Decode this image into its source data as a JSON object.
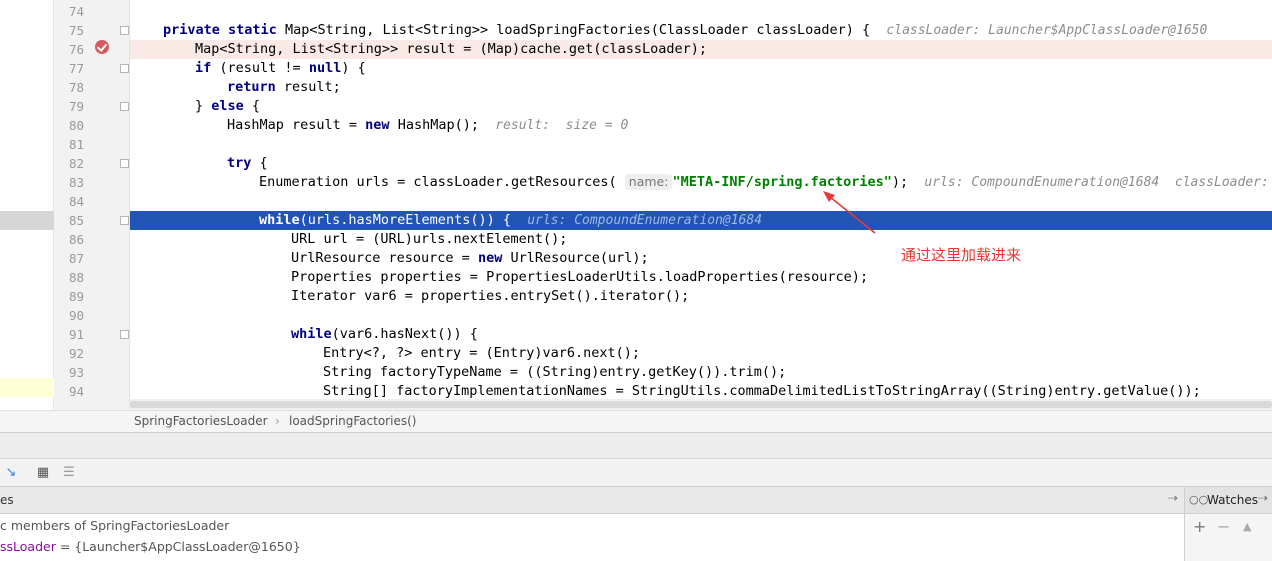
{
  "editor": {
    "line_numbers": [
      "74",
      "75",
      "76",
      "77",
      "78",
      "79",
      "80",
      "81",
      "82",
      "83",
      "84",
      "85",
      "86",
      "87",
      "88",
      "89",
      "90",
      "91",
      "92",
      "93",
      "94"
    ],
    "code": {
      "l75_private": "private",
      "l75_static": "static",
      "l75_sig": " Map<String, List<String>> loadSpringFactories(ClassLoader classLoader) {",
      "l75_hint": "classLoader: Launcher$AppClassLoader@1650",
      "l76": "Map<String, List<String>> result = (Map)cache.get(classLoader);",
      "l77_if": "if",
      "l77_a": " (result != ",
      "l77_null": "null",
      "l77_b": ") {",
      "l78_return": "return",
      "l78_b": " result;",
      "l79_a": "} ",
      "l79_else": "else",
      "l79_b": " {",
      "l80_a": "HashMap result = ",
      "l80_new": "new",
      "l80_b": " HashMap();",
      "l80_hint": "result:  size = 0",
      "l82_try": "try",
      "l82_b": " {",
      "l83_a": "Enumeration urls = classLoader.getResources(",
      "l83_param": "name:",
      "l83_str": "\"META-INF/spring.factories\"",
      "l83_b": ");",
      "l83_hint": "urls: CompoundEnumeration@1684  classLoader:",
      "l85_while": "while",
      "l85_b": "(urls.hasMoreElements()) {",
      "l85_hint": "urls: CompoundEnumeration@1684",
      "l86": "URL url = (URL)urls.nextElement();",
      "l87_a": "UrlResource resource = ",
      "l87_new": "new",
      "l87_b": " UrlResource(url);",
      "l88": "Properties properties = PropertiesLoaderUtils.loadProperties(resource);",
      "l89": "Iterator var6 = properties.entrySet().iterator();",
      "l91_while": "while",
      "l91_b": "(var6.hasNext()) {",
      "l92": "Entry<?, ?> entry = (Entry)var6.next();",
      "l93": "String factoryTypeName = ((String)entry.getKey()).trim();",
      "l94": "String[] factoryImplementationNames = StringUtils.commaDelimitedListToStringArray((String)entry.getValue());"
    }
  },
  "annotation": {
    "text": "通过这里加载进来",
    "color": "#e53935"
  },
  "breadcrumb": {
    "class_name": "SpringFactoriesLoader",
    "separator": "›",
    "method_name": "loadSpringFactories()"
  },
  "debugger": {
    "frames_label": "es",
    "watches_label": "Watches",
    "variables": {
      "static_members": "c members of SpringFactoriesLoader",
      "var_name": "ssLoader",
      "var_value": " = {Launcher$AppClassLoader@1650}"
    }
  },
  "colors": {
    "current_line": "#2154b4",
    "breakpoint": "#db5860",
    "keyword": "#000080",
    "string": "#008000"
  }
}
